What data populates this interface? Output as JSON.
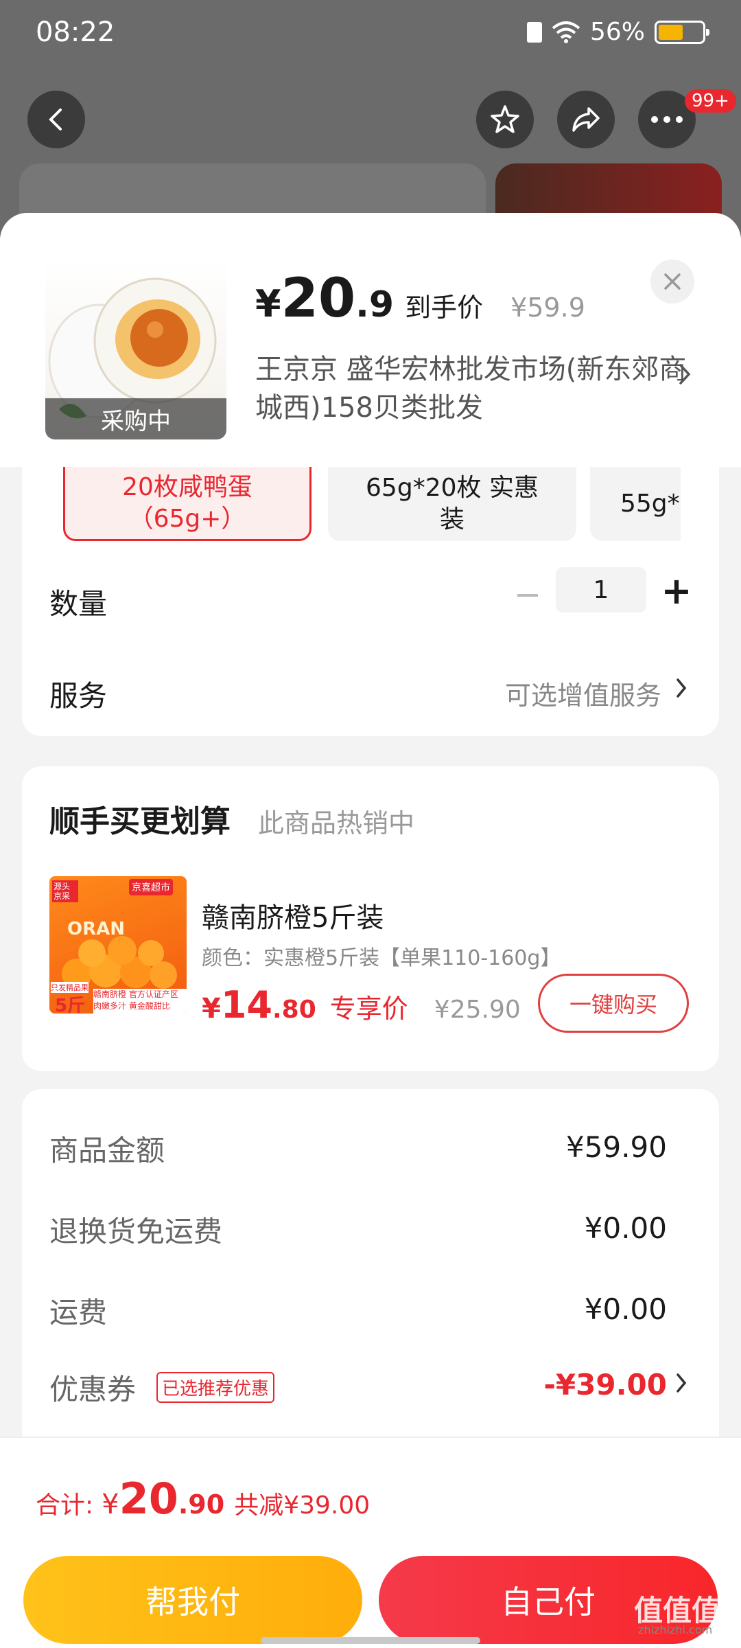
{
  "status_bar": {
    "time": "08:22",
    "battery": "56%",
    "battery_level": 0.56
  },
  "nav": {
    "badge": "99+"
  },
  "product": {
    "image_label": "采购中",
    "price_symbol": "¥",
    "price_int": "20",
    "price_dec": ".9",
    "price_tag": "到手价",
    "original_price": "¥59.9",
    "store": "王京京  盛华宏林批发市场(新东郊商城西)158贝类批发"
  },
  "specs": [
    {
      "label": "20枚咸鸭蛋（65g+）",
      "selected": true
    },
    {
      "label": "65g*20枚 实惠装",
      "selected": false
    },
    {
      "label": "55g*",
      "selected": false
    }
  ],
  "quantity": {
    "label": "数量",
    "value": "1",
    "minus": "−",
    "plus": "+"
  },
  "service": {
    "label": "服务",
    "value": "可选增值服务"
  },
  "upsell": {
    "title": "顺手买更划算",
    "subtitle": "此商品热销中",
    "item_name": "赣南脐橙5斤装",
    "item_desc": "颜色：实惠橙5斤装【单果110-160g】",
    "price_symbol": "¥",
    "price_int": "14",
    "price_dec": ".80",
    "price_tag": "专享价",
    "original_price": "¥25.90",
    "buy_button": "一键购买",
    "image_texts": {
      "source": "源头 京采",
      "brand": "京喜超市",
      "orange": "ORAN",
      "weight": "5斤",
      "tag1": "赣南脐橙 官方认证产区",
      "tag2": "肉嫩多汁 黄金酸甜比",
      "small": "只发精品果"
    }
  },
  "summary": {
    "rows": [
      {
        "label": "商品金额",
        "value": "¥59.90"
      },
      {
        "label": "退换货免运费",
        "value": "¥0.00"
      },
      {
        "label": "运费",
        "value": "¥0.00"
      }
    ],
    "coupon_label": "优惠券",
    "coupon_badge": "已选推荐优惠",
    "coupon_value": "-¥39.00"
  },
  "total": {
    "label": "合计:",
    "symbol": "¥",
    "int": "20",
    "dec": ".90",
    "saving": "共减¥39.00"
  },
  "actions": {
    "help_pay": "帮我付",
    "self_pay": "自己付"
  },
  "watermark": {
    "main": "值值值",
    "sub": "zhizhizhi.com"
  }
}
